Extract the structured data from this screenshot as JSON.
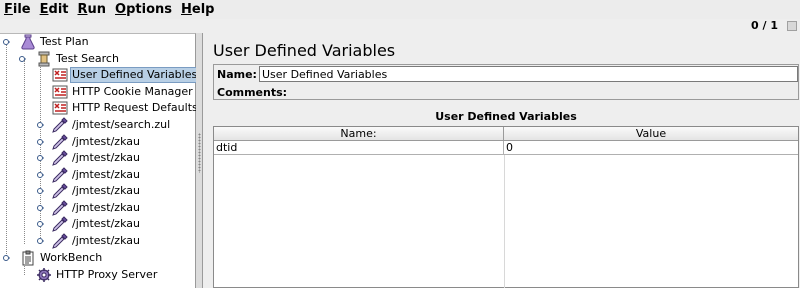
{
  "menu": {
    "items": [
      {
        "key": "F",
        "rest": "ile"
      },
      {
        "key": "E",
        "rest": "dit"
      },
      {
        "key": "R",
        "rest": "un"
      },
      {
        "key": "O",
        "rest": "ptions"
      },
      {
        "key": "H",
        "rest": "elp"
      }
    ]
  },
  "status": {
    "counter": "0 / 1"
  },
  "tree": {
    "test_plan": "Test Plan",
    "thread_group": "Test Search",
    "udv": "User Defined Variables",
    "cookie_manager": "HTTP Cookie Manager",
    "request_defaults": "HTTP Request Defaults",
    "samplers": [
      "/jmtest/search.zul",
      "/jmtest/zkau",
      "/jmtest/zkau",
      "/jmtest/zkau",
      "/jmtest/zkau",
      "/jmtest/zkau",
      "/jmtest/zkau",
      "/jmtest/zkau"
    ],
    "workbench": "WorkBench",
    "proxy": "HTTP Proxy Server"
  },
  "panel": {
    "title": "User Defined Variables",
    "name_label": "Name:",
    "name_value": "User Defined Variables",
    "comments_label": "Comments:",
    "table_title": "User Defined Variables",
    "columns": [
      "Name:",
      "Value"
    ],
    "rows": [
      {
        "name": "dtid",
        "value": "0"
      }
    ]
  },
  "colors": {
    "selection": "#b8cfe5",
    "panel_bg": "#eeeeee",
    "tree_bg": "#ffffff"
  }
}
